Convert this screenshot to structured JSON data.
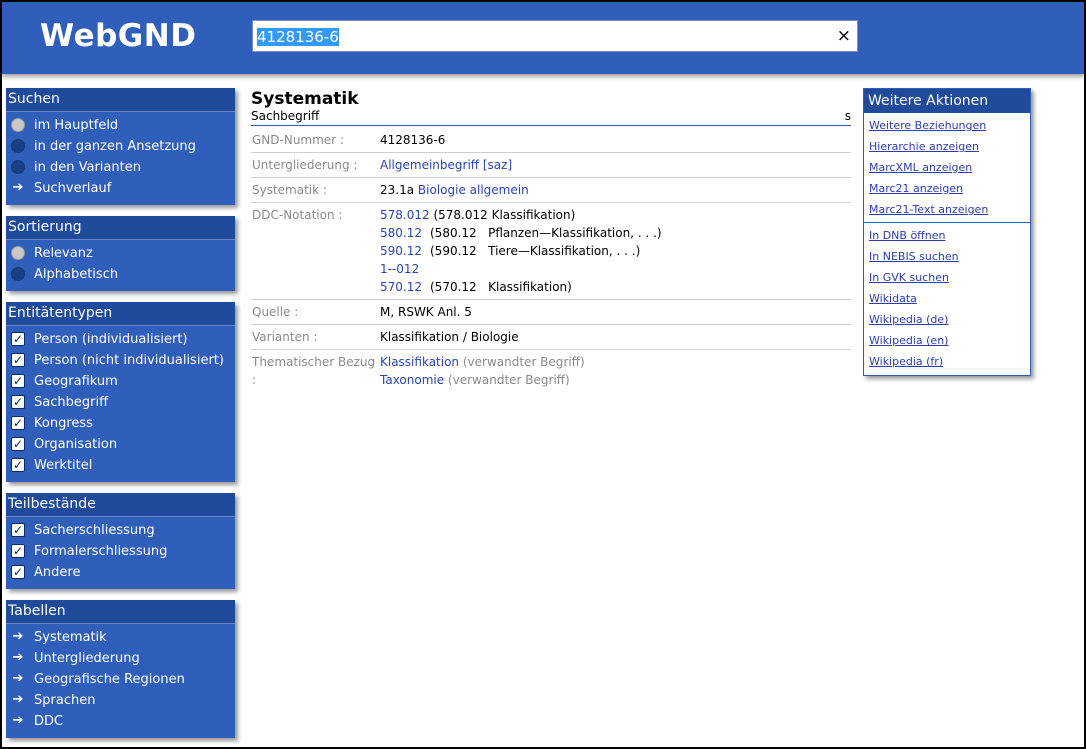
{
  "app": {
    "logo": "WebGND"
  },
  "search": {
    "value": "4128136-6",
    "clear": "×"
  },
  "sidebar": {
    "suchen": {
      "title": "Suchen",
      "items": [
        {
          "label": "im Hauptfeld",
          "kind": "radio",
          "selected": true
        },
        {
          "label": "in der ganzen Ansetzung",
          "kind": "radio",
          "selected": false
        },
        {
          "label": "in den Varianten",
          "kind": "radio",
          "selected": false
        },
        {
          "label": "Suchverlauf",
          "kind": "arrow"
        }
      ]
    },
    "sortierung": {
      "title": "Sortierung",
      "items": [
        {
          "label": "Relevanz",
          "kind": "radio",
          "selected": true
        },
        {
          "label": "Alphabetisch",
          "kind": "radio",
          "selected": false
        }
      ]
    },
    "entitaetentypen": {
      "title": "Entitätentypen",
      "items": [
        {
          "label": "Person (individualisiert)",
          "checked": true
        },
        {
          "label": "Person (nicht individualisiert)",
          "checked": true
        },
        {
          "label": "Geografikum",
          "checked": true
        },
        {
          "label": "Sachbegriff",
          "checked": true
        },
        {
          "label": "Kongress",
          "checked": true
        },
        {
          "label": "Organisation",
          "checked": true
        },
        {
          "label": "Werktitel",
          "checked": true
        }
      ]
    },
    "teilbestaende": {
      "title": "Teilbestände",
      "items": [
        {
          "label": "Sacherschliessung",
          "checked": true
        },
        {
          "label": "Formalerschliessung",
          "checked": true
        },
        {
          "label": "Andere",
          "checked": true
        }
      ]
    },
    "tabellen": {
      "title": "Tabellen",
      "items": [
        {
          "label": "Systematik"
        },
        {
          "label": "Untergliederung"
        },
        {
          "label": "Geografische Regionen"
        },
        {
          "label": "Sprachen"
        },
        {
          "label": "DDC"
        }
      ]
    }
  },
  "main": {
    "title": "Systematik",
    "subtitle": "Sachbegriff",
    "subtitle_right": "s",
    "rows": {
      "gnd": {
        "label": "GND-Nummer :",
        "value": "4128136-6"
      },
      "unter": {
        "label": "Untergliederung :",
        "link": "Allgemeinbegriff [saz]"
      },
      "syst": {
        "label": "Systematik :",
        "code": "23.1a",
        "link": "Biologie allgemein"
      },
      "ddc": {
        "label": "DDC-Notation :",
        "entries": [
          {
            "code": "578.012",
            "text": "(578.012 Klassifikation)"
          },
          {
            "code": "580.12",
            "text": "(580.12   Pflanzen—Klassifikation, . . .)"
          },
          {
            "code": "590.12",
            "text": "(590.12   Tiere—Klassifikation, . . .)"
          },
          {
            "code": "1--012",
            "text": ""
          },
          {
            "code": "570.12",
            "text": "(570.12   Klassifikation)"
          }
        ]
      },
      "quelle": {
        "label": "Quelle :",
        "value": "M, RSWK Anl. 5"
      },
      "varianten": {
        "label": "Varianten :",
        "value": "Klassifikation / Biologie"
      },
      "bezug": {
        "label": "Thematischer Bezug :",
        "entries": [
          {
            "link": "Klassifikation",
            "note": "(verwandter Begriff)"
          },
          {
            "link": "Taxonomie",
            "note": "(verwandter Begriff)"
          }
        ]
      }
    }
  },
  "actions": {
    "title": "Weitere Aktionen",
    "group1": [
      "Weitere Beziehungen",
      "Hierarchie anzeigen",
      "MarcXML anzeigen",
      "Marc21 anzeigen",
      "Marc21-Text anzeigen"
    ],
    "group2": [
      "In DNB öffnen",
      "In NEBIS suchen",
      "In GVK suchen",
      "Wikidata",
      "Wikipedia (de)",
      "Wikipedia (en)",
      "Wikipedia (fr)"
    ]
  },
  "colors": {
    "header": "#2f5fba",
    "panel_title": "#1f4b9a",
    "link": "#2944b6"
  }
}
